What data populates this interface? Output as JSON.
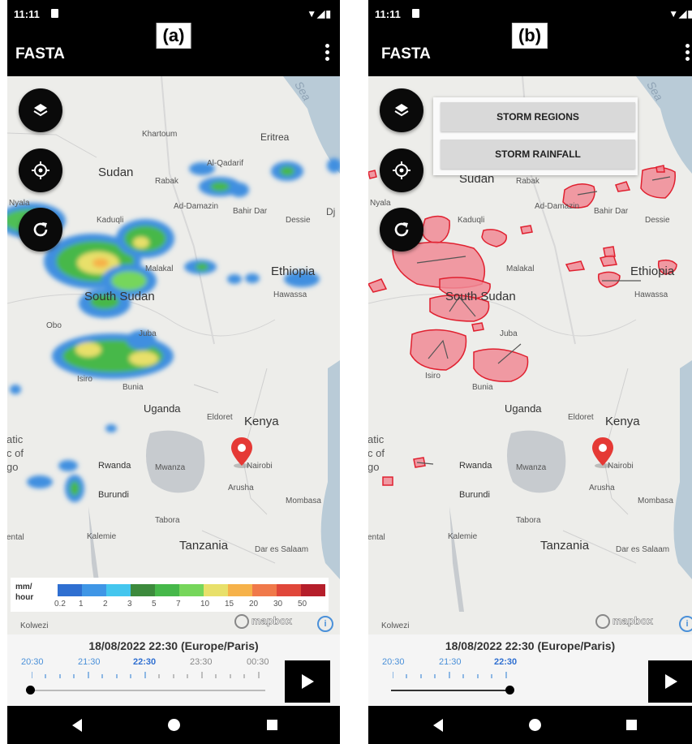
{
  "panels": [
    {
      "label": "(a)",
      "status_time": "11:11",
      "app_title": "FASTA",
      "map_labels": {
        "sea": "Sea",
        "sudan": "Sudan",
        "khartoum": "Khartoum",
        "eritrea": "Eritrea",
        "al_qadarif": "Al-Qadarif",
        "rabak": "Rabak",
        "ad_damazin": "Ad-Damazin",
        "bahir_dar": "Bahir Dar",
        "dessie": "Dessie",
        "kaduqli": "Kaduqli",
        "nyala": "Nyala",
        "malakal": "Malakal",
        "ethiopia": "Ethiopia",
        "hawassa": "Hawassa",
        "south_sudan": "South Sudan",
        "obo": "Obo",
        "juba": "Juba",
        "isiro": "Isiro",
        "bunia": "Bunia",
        "uganda": "Uganda",
        "eldoret": "Eldoret",
        "kenya": "Kenya",
        "rwanda": "Rwanda",
        "mwanza": "Mwanza",
        "nairobi": "Nairobi",
        "burundi": "Burundi",
        "arusha": "Arusha",
        "mombasa": "Mombasa",
        "tabora": "Tabora",
        "kalemie": "Kalemie",
        "tanzania": "Tanzania",
        "dar_es_salaam": "Dar es Salaam",
        "kolwezi": "Kolwezi",
        "dj": "Dj",
        "congo_1": "atic",
        "congo_2": "c of",
        "congo_3": "go",
        "ental": "ental"
      },
      "legend": {
        "unit_line1": "mm/",
        "unit_line2": "hour",
        "ticks": [
          "0.2",
          "1",
          "2",
          "3",
          "5",
          "7",
          "10",
          "15",
          "20",
          "30",
          "50"
        ],
        "colors": [
          "#2f6fd1",
          "#3f96e6",
          "#44c6ee",
          "#3d8a3d",
          "#46b84a",
          "#76d65b",
          "#e8e06a",
          "#f6b24a",
          "#f0794a",
          "#e0473a",
          "#b51e2a"
        ]
      },
      "attribution": "mapbox",
      "info_label": "i",
      "timestamp": "18/08/2022 22:30 (Europe/Paris)",
      "time_labels": [
        "20:30",
        "21:30",
        "22:30",
        "23:30",
        "00:30"
      ],
      "slider_progress": 0.0
    },
    {
      "label": "(b)",
      "status_time": "11:11",
      "app_title": "FASTA",
      "menu": [
        "STORM REGIONS",
        "STORM RAINFALL"
      ],
      "map_labels": {
        "sea": "Sea",
        "sudan": "Sudan",
        "rabak": "Rabak",
        "ad_damazin": "Ad-Damazin",
        "bahir_dar": "Bahir Dar",
        "dessie": "Dessie",
        "kaduqli": "Kaduqli",
        "nyala": "Nyala",
        "malakal": "Malakal",
        "ethiopia": "Ethiopia",
        "hawassa": "Hawassa",
        "south_sudan": "South Sudan",
        "juba": "Juba",
        "isiro": "Isiro",
        "bunia": "Bunia",
        "uganda": "Uganda",
        "eldoret": "Eldoret",
        "kenya": "Kenya",
        "rwanda": "Rwanda",
        "mwanza": "Mwanza",
        "nairobi": "Nairobi",
        "burundi": "Burundi",
        "arusha": "Arusha",
        "mombasa": "Mombasa",
        "tabora": "Tabora",
        "kalemie": "Kalemie",
        "tanzania": "Tanzania",
        "dar_es_salaam": "Dar es Salaam",
        "kolwezi": "Kolwezi",
        "congo_1": "atic",
        "congo_2": "c of",
        "congo_3": "go",
        "ental": "ental"
      },
      "attribution": "mapbox",
      "info_label": "i",
      "timestamp": "18/08/2022 22:30 (Europe/Paris)",
      "time_labels": [
        "20:30",
        "21:30",
        "22:30"
      ],
      "slider_progress": 1.0
    }
  ],
  "colors": {
    "status_bar": "#000000",
    "time_label_blue": "#4a90d9",
    "storm_fill": "#f08a95",
    "storm_stroke": "#e0202f",
    "marker": "#e53935"
  }
}
